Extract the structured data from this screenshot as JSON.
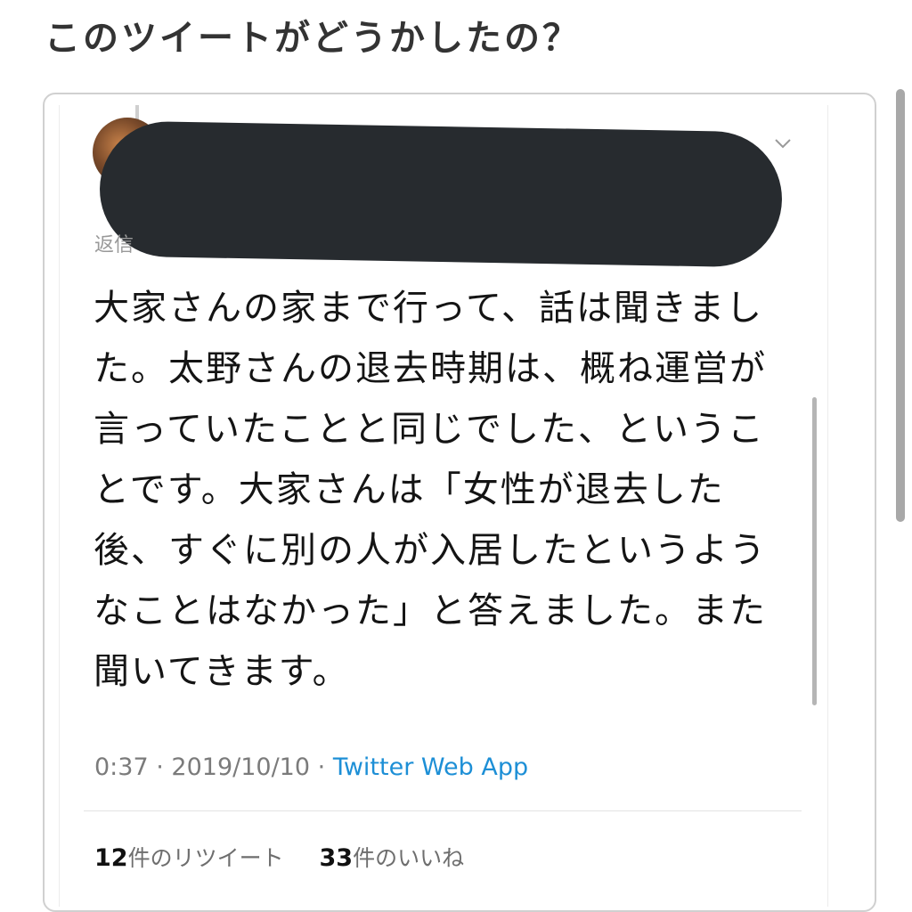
{
  "page_title": "このツイートがどうかしたの？",
  "tweet": {
    "reply_prefix": "返信",
    "body": "大家さんの家まで行って、話は聞きました。太野さんの退去時期は、概ね運営が言っていたことと同じでした、ということです。大家さんは「女性が退去した後、すぐに別の人が入居したというようなことはなかった」と答えました。また聞いてきます。",
    "time": "0:37",
    "date": "2019/10/10",
    "separator": "·",
    "client": "Twitter Web App",
    "retweet_count": "12",
    "retweet_label": "件のリツイート",
    "like_count": "33",
    "like_label": "件のいいね"
  },
  "icons": {
    "menu": "chevron-down-icon",
    "avatar": "avatar"
  },
  "colors": {
    "link": "#1d8fd6",
    "redaction": "#272b2f"
  }
}
